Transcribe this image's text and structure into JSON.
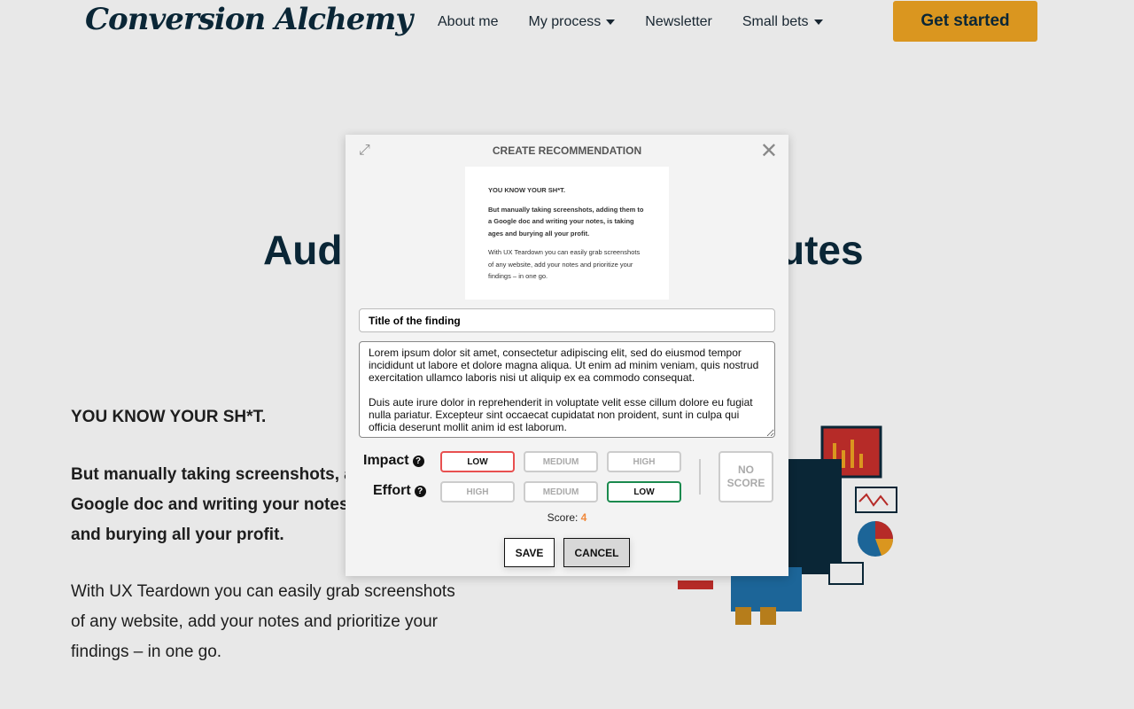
{
  "header": {
    "logo": "Conversion Alchemy",
    "nav": [
      {
        "label": "About me",
        "dropdown": false
      },
      {
        "label": "My process",
        "dropdown": true
      },
      {
        "label": "Newsletter",
        "dropdown": false
      },
      {
        "label": "Small bets",
        "dropdown": true
      }
    ],
    "cta": "Get started"
  },
  "hero": {
    "heading_left": "Aud",
    "heading_right": "utes"
  },
  "content": {
    "p1": "YOU KNOW YOUR SH*T.",
    "p2_lines": [
      "But manually taking screenshots, a",
      "Google doc and writing your notes,",
      "and burying all your profit."
    ],
    "p3_lines": [
      "With UX Teardown you can easily grab screenshots",
      "of any website, add your notes and prioritize your",
      "findings – in one go."
    ]
  },
  "modal": {
    "title": "CREATE RECOMMENDATION",
    "screenshot": {
      "p1": "YOU KNOW YOUR SH*T.",
      "p2": "But manually taking screenshots, adding them to a Google doc and writing your notes, is taking ages and burying all your profit.",
      "p3": "With UX Teardown you can easily grab screenshots of any website, add your notes and prioritize your findings – in one go."
    },
    "title_value": "Title of the finding",
    "description": "Lorem ipsum dolor sit amet, consectetur adipiscing elit, sed do eiusmod tempor incididunt ut labore et dolore magna aliqua. Ut enim ad minim veniam, quis nostrud exercitation ullamco laboris nisi ut aliquip ex ea commodo consequat.\n\nDuis aute irure dolor in reprehenderit in voluptate velit esse cillum dolore eu fugiat nulla pariatur. Excepteur sint occaecat cupidatat non proident, sunt in culpa qui officia deserunt mollit anim id est laborum.",
    "impact": {
      "label": "Impact",
      "options": [
        "LOW",
        "MEDIUM",
        "HIGH"
      ],
      "selected": "LOW"
    },
    "effort": {
      "label": "Effort",
      "options": [
        "HIGH",
        "MEDIUM",
        "LOW"
      ],
      "selected": "LOW"
    },
    "no_score": "NO SCORE",
    "score_label": "Score:",
    "score_value": "4",
    "save": "SAVE",
    "cancel": "CANCEL",
    "colors": {
      "impact_selected": "#e85050",
      "effort_selected": "#1b8a4e",
      "score": "#f0883a"
    }
  }
}
